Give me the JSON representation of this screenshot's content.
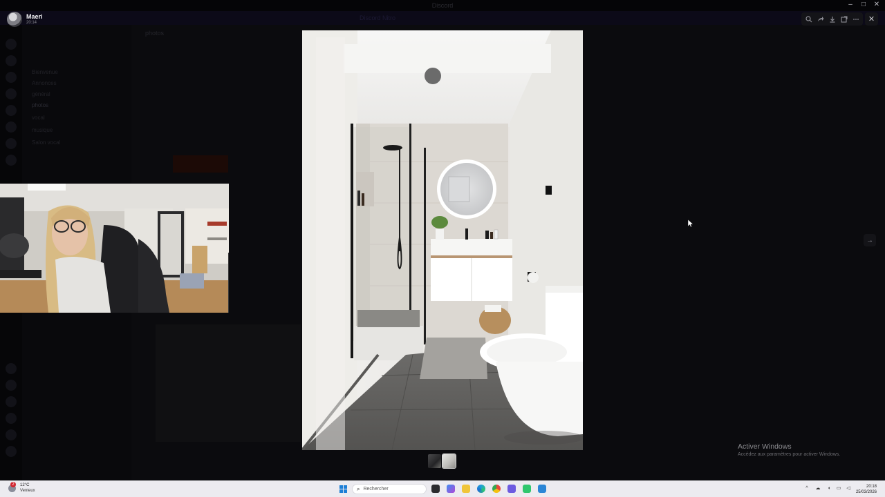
{
  "window": {
    "title": "Discord"
  },
  "background": {
    "banner_text": "Discord Nitro",
    "channels": [
      "Bienvenue",
      "Annonces",
      "général",
      "photos",
      "vocal",
      "musique",
      "Salon vocal"
    ],
    "active_channel": "photos",
    "channel_header": "photos"
  },
  "viewer": {
    "username": "Maeri",
    "timestamp": "20:14",
    "tools": [
      "zoom-icon",
      "share-icon",
      "download-icon",
      "open-external-icon",
      "more-icon"
    ],
    "thumbnail_count": 2,
    "selected_thumbnail": 2
  },
  "activate_windows": {
    "title": "Activer Windows",
    "subtitle": "Accédez aux paramètres pour activer Windows."
  },
  "taskbar": {
    "weather_temp": "12°C",
    "weather_condition": "Venteux",
    "weather_badge": "2",
    "search_placeholder": "Rechercher",
    "clock_time": "20:18",
    "clock_date": "25/03/2026"
  },
  "colors": {
    "accent": "#1d7fd6",
    "overlay": "#000000"
  }
}
